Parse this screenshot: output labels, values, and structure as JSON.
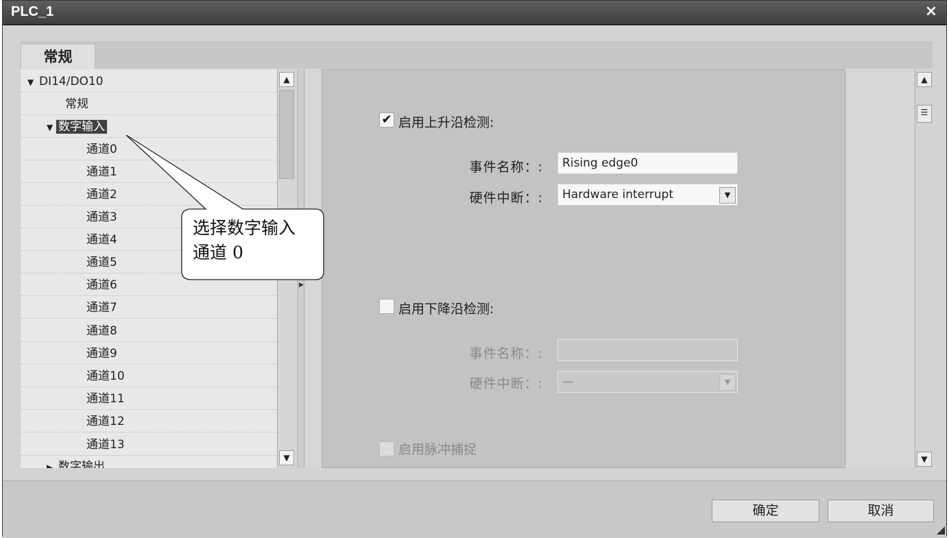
{
  "window": {
    "title": "PLC_1",
    "close_symbol": "×"
  },
  "tabs": [
    {
      "label": "常规"
    }
  ],
  "tree": {
    "root": "DI14/DO10",
    "items": [
      {
        "label": "常规"
      },
      {
        "label": "数字输入"
      },
      {
        "label": "通道0"
      },
      {
        "label": "通道1"
      },
      {
        "label": "通道2"
      },
      {
        "label": "通道3"
      },
      {
        "label": "通道4"
      },
      {
        "label": "通道5"
      },
      {
        "label": "通道6"
      },
      {
        "label": "通道7"
      },
      {
        "label": "通道8"
      },
      {
        "label": "通道9"
      },
      {
        "label": "通道10"
      },
      {
        "label": "通道11"
      },
      {
        "label": "通道12"
      },
      {
        "label": "通道13"
      },
      {
        "label": "数字输出"
      }
    ],
    "selected": "数字输入"
  },
  "callout": {
    "text": "选择数字输入\n通道 0"
  },
  "rising": {
    "label": "启用上升沿检测:",
    "checked": true,
    "event_name_label": "事件名称：:",
    "event_name_value": "Rising edge0",
    "hw_interrupt_label": "硬件中断：:",
    "hw_interrupt_value": "Hardware interrupt"
  },
  "falling": {
    "label": "启用下降沿检测:",
    "checked": false,
    "event_name_label": "事件名称：:",
    "event_name_value": "",
    "hw_interrupt_label": "硬件中断：:",
    "hw_interrupt_value": "—"
  },
  "pulse": {
    "label": "启用脉冲捕捉"
  },
  "buttons": {
    "ok": "确定",
    "cancel": "取消"
  },
  "icons": {
    "check": "✔",
    "expand": "▼",
    "collapse": "▶",
    "scroll_up": "▲",
    "scroll_down": "▼",
    "dropdown": "▼",
    "splitter": "▶",
    "scroll_grip": "☰"
  },
  "colors": {
    "titlebar": "#4a4a4a",
    "selected_bg": "#404040",
    "panel_bg": "#c3c3c3"
  }
}
